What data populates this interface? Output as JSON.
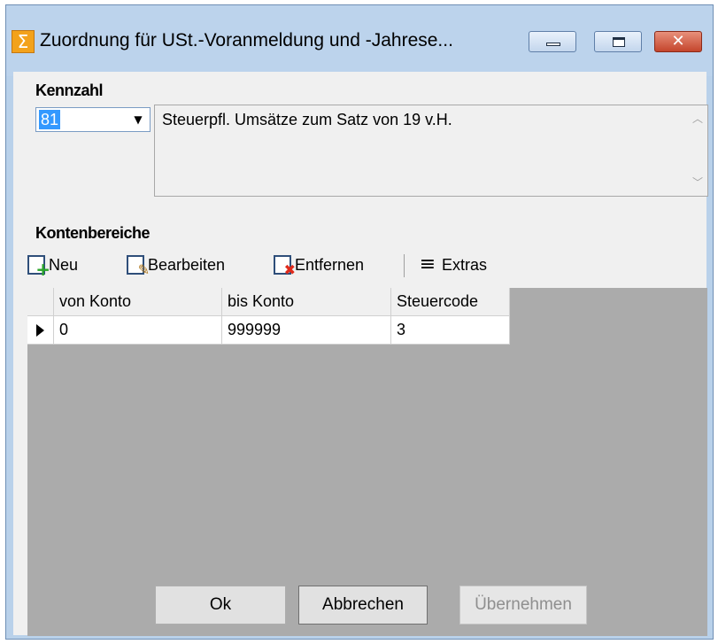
{
  "window": {
    "title": "Zuordnung für USt.-Voranmeldung und -Jahrese...",
    "app_icon": "sigma-icon",
    "controls": [
      "minimize-icon",
      "maximize-icon",
      "close-icon"
    ]
  },
  "kennzahl": {
    "label": "Kennzahl",
    "selected_value": "81",
    "description": "Steuerpfl. Umsätze zum Satz von 19 v.H."
  },
  "kontenbereiche": {
    "label": "Kontenbereiche",
    "toolbar": {
      "new_label": "Neu",
      "edit_label": "Bearbeiten",
      "delete_label": "Entfernen",
      "extras_label": "Extras"
    },
    "columns": [
      "von Konto",
      "bis Konto",
      "Steuercode"
    ],
    "rows": [
      {
        "von": "0",
        "bis": "999999",
        "code": "3"
      }
    ]
  },
  "buttons": {
    "ok": "Ok",
    "cancel": "Abbrechen",
    "apply": "Übernehmen"
  },
  "colors": {
    "selection": "#3399ff",
    "close_button": "#c4452c",
    "disabled_text": "#8f8f8f"
  }
}
